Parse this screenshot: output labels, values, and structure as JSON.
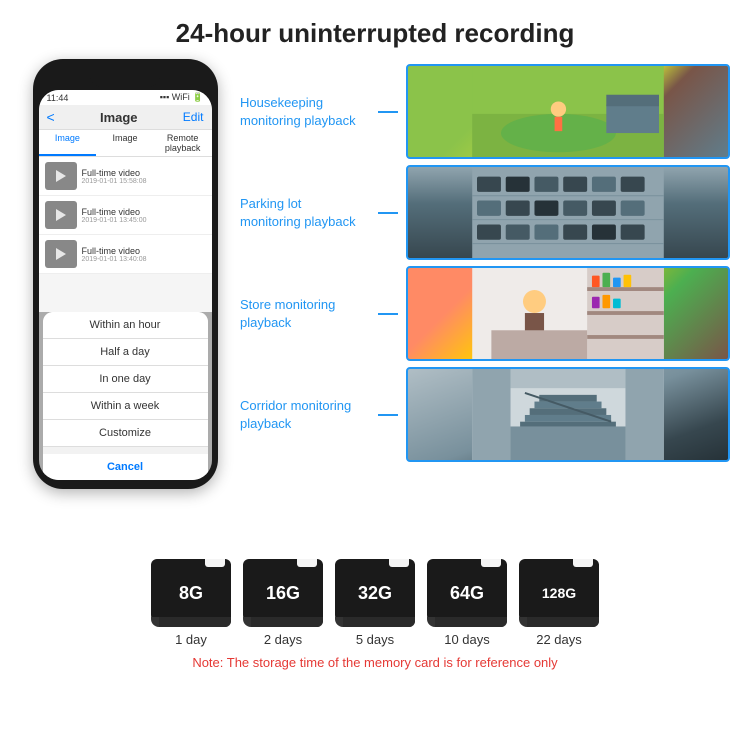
{
  "header": {
    "title": "24-hour uninterrupted recording"
  },
  "phone": {
    "status_time": "11:44",
    "nav_back": "<",
    "nav_title": "Image",
    "nav_edit": "Edit",
    "tabs": [
      "Image",
      "Image",
      "Remote playback"
    ],
    "list_items": [
      {
        "title": "Full-time video",
        "date": "2019-01-01 15:58:08"
      },
      {
        "title": "Full-time video",
        "date": "2019-01-01 13:45:00"
      },
      {
        "title": "Full-time video",
        "date": "2019-01-01 13:40:08"
      }
    ],
    "dropdown_items": [
      "Within an hour",
      "Half a day",
      "In one day",
      "Within a week",
      "Customize"
    ],
    "cancel_label": "Cancel"
  },
  "monitoring": {
    "items": [
      {
        "label": "Housekeeping\nmonitoring playback",
        "scene": "housekeeping"
      },
      {
        "label": "Parking lot\nmonitoring playback",
        "scene": "parking"
      },
      {
        "label": "Store monitoring\nplayback",
        "scene": "store"
      },
      {
        "label": "Corridor monitoring\nplayback",
        "scene": "corridor"
      }
    ]
  },
  "storage": {
    "cards": [
      {
        "size": "8G",
        "days": "1 day"
      },
      {
        "size": "16G",
        "days": "2 days"
      },
      {
        "size": "32G",
        "days": "5 days"
      },
      {
        "size": "64G",
        "days": "10 days"
      },
      {
        "size": "128G",
        "days": "22 days"
      }
    ],
    "note": "Note: The storage time of the memory card is for reference only"
  }
}
